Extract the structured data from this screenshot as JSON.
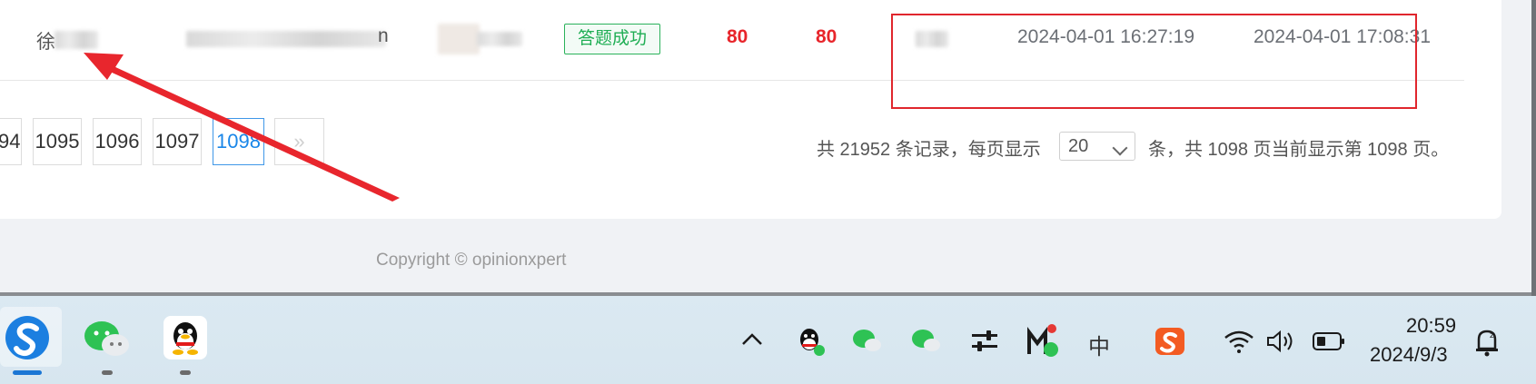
{
  "table": {
    "row": {
      "name_visible_char": "徐",
      "email_tail": "n",
      "status_badge": "答题成功",
      "score_1": "80",
      "score_2": "80",
      "start_time": "2024-04-01 16:27:19",
      "end_time": "2024-04-01 17:08:31"
    }
  },
  "pagination": {
    "pages": [
      "94",
      "1095",
      "1096",
      "1097",
      "1098"
    ],
    "active_page": "1098",
    "next_label": "»",
    "summary_prefix": "共 21952 条记录，每页显示",
    "page_size": "20",
    "summary_suffix": "条，共 1098 页当前显示第 1098 页。"
  },
  "footer": {
    "copyright": "Copyright © opinionxpert"
  },
  "taskbar": {
    "apps": [
      "sogou-browser-icon",
      "wechat-icon",
      "qq-icon"
    ],
    "tray": {
      "ime_label": "中",
      "clock_time": "20:59",
      "clock_date": "2024/9/3"
    }
  },
  "colors": {
    "score_red": "#e8252b",
    "success_green": "#1fae54",
    "active_blue": "#1a86e8",
    "annotation_red": "#e0262d"
  }
}
